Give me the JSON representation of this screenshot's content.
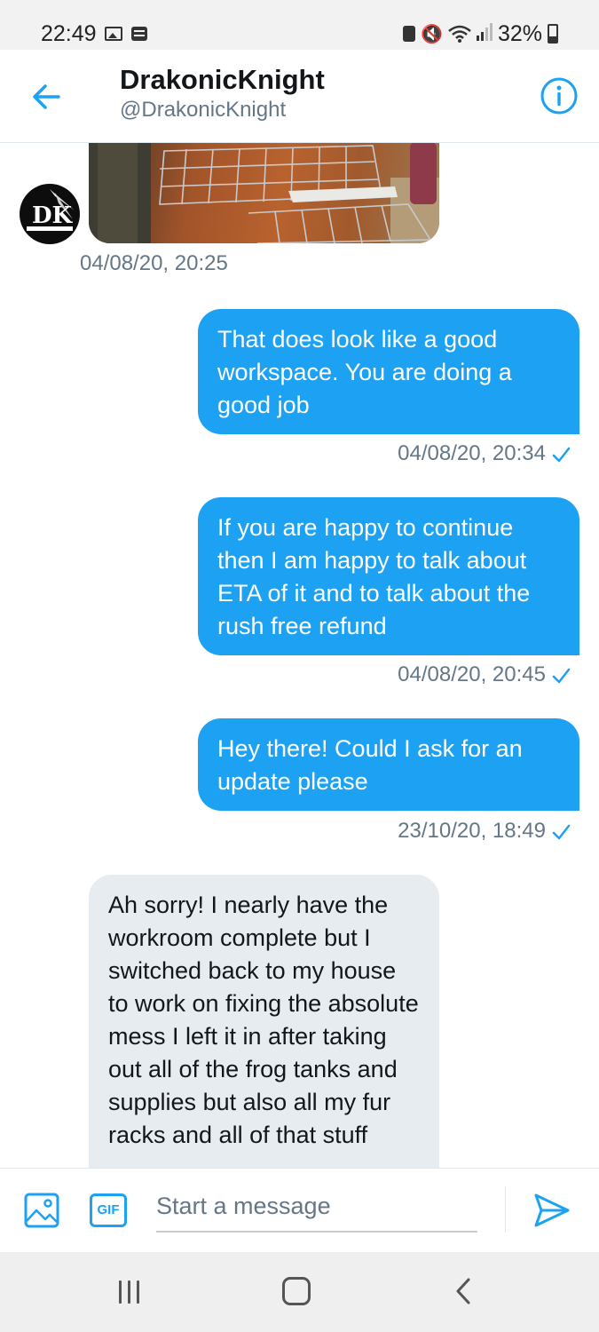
{
  "status_bar": {
    "time": "22:49",
    "battery": "32%",
    "icons": [
      "gallery-icon",
      "message-icon",
      "battery-saver-icon",
      "mute-icon",
      "wifi-icon",
      "signal-icon",
      "battery-icon"
    ]
  },
  "header": {
    "name": "DrakonicKnight",
    "handle": "@DrakonicKnight",
    "back_icon": "arrow-left-icon",
    "info_icon": "info-icon"
  },
  "messages": [
    {
      "type": "image",
      "sender": "them",
      "timestamp": "04/08/20, 20:25"
    },
    {
      "type": "text",
      "sender": "me",
      "text": "That does look like a good workspace. You are doing a good job",
      "timestamp": "04/08/20, 20:34"
    },
    {
      "type": "text",
      "sender": "me",
      "text": "If you are happy to continue then I am happy to talk about ETA of it and to talk about the rush free refund",
      "timestamp": "04/08/20, 20:45"
    },
    {
      "type": "text",
      "sender": "me",
      "text": "Hey there! Could I ask for an update please",
      "timestamp": "23/10/20, 18:49"
    },
    {
      "type": "text",
      "sender": "them",
      "text": "Ah sorry! I nearly have the workroom complete but I switched back to my house to work on fixing the absolute mess I left it in after taking out all of the frog tanks and supplies but also all my fur racks and all of that stuff"
    }
  ],
  "composer": {
    "placeholder": "Start a message",
    "gif_label": "GIF"
  },
  "colors": {
    "accent": "#1da1f2",
    "incoming_bubble": "#e6ecf0",
    "secondary_text": "#657786"
  }
}
